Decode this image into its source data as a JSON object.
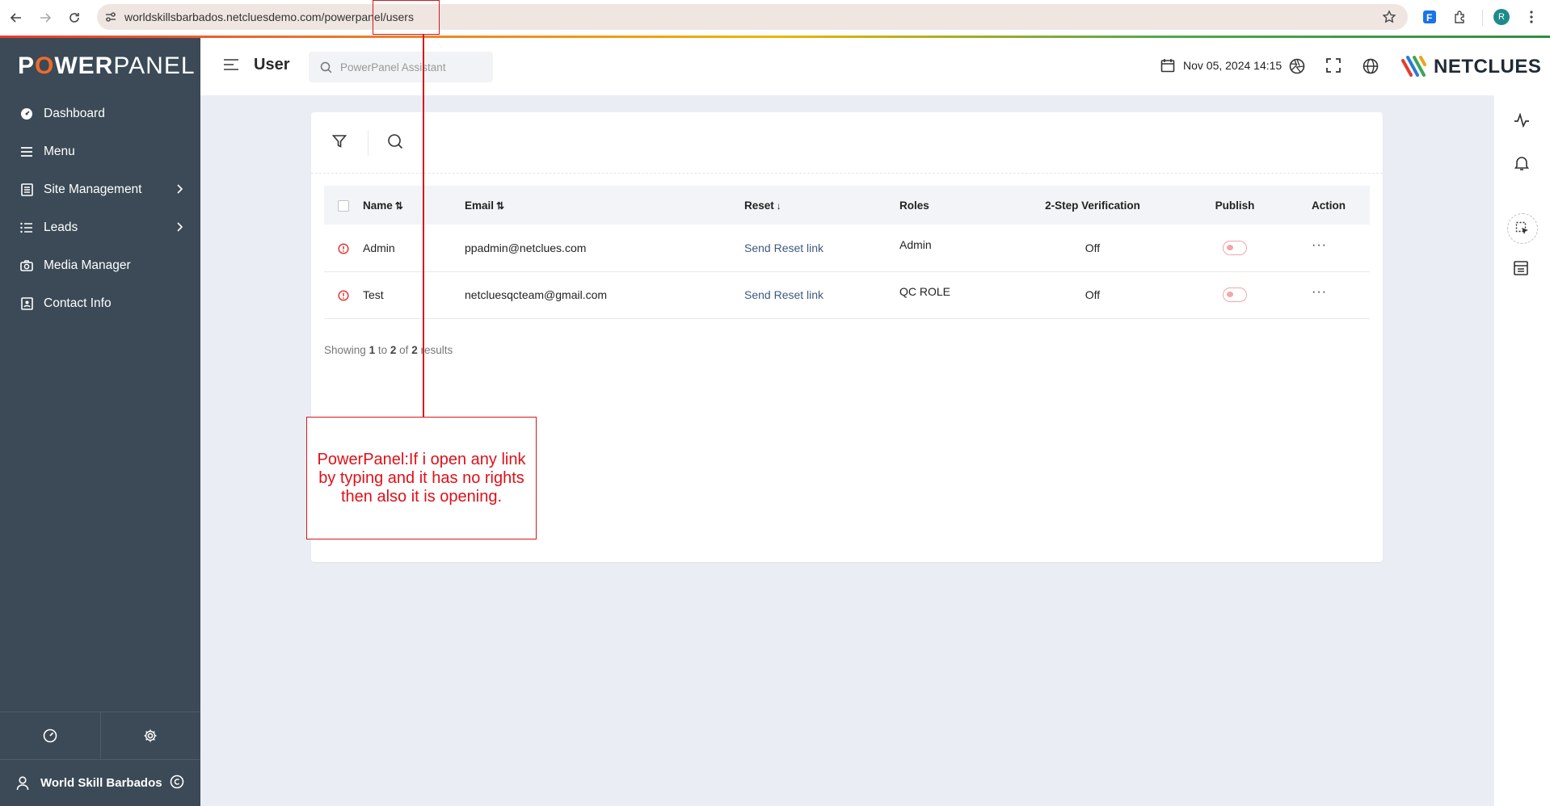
{
  "browser": {
    "url": "worldskillsbarbados.netcluesdemo.com/powerpanel/users",
    "profile_initial": "R",
    "ext_label": "F"
  },
  "sidebar": {
    "logo": {
      "part1": "P",
      "part2": "O",
      "part3": "WER",
      "part4": "PANEL"
    },
    "items": [
      {
        "label": "Dashboard",
        "icon": "dashboard-icon",
        "has_chevron": false
      },
      {
        "label": "Menu",
        "icon": "menu-lines-icon",
        "has_chevron": false
      },
      {
        "label": "Site Management",
        "icon": "site-management-icon",
        "has_chevron": true
      },
      {
        "label": "Leads",
        "icon": "leads-list-icon",
        "has_chevron": true
      },
      {
        "label": "Media Manager",
        "icon": "camera-icon",
        "has_chevron": false
      },
      {
        "label": "Contact Info",
        "icon": "contact-card-icon",
        "has_chevron": false
      }
    ],
    "user_name": "World Skill Barbados"
  },
  "header": {
    "title": "User",
    "search_placeholder": "PowerPanel Assistant",
    "datetime": "Nov 05, 2024 14:15",
    "brand": "NETCLUES"
  },
  "table": {
    "columns": {
      "name": "Name",
      "email": "Email",
      "reset": "Reset",
      "roles": "Roles",
      "two_step": "2-Step Verification",
      "publish": "Publish",
      "action": "Action"
    },
    "sort_icons": {
      "name": "⇅",
      "email": "⇅",
      "reset": "↓"
    },
    "rows": [
      {
        "name": "Admin",
        "email": "ppadmin@netclues.com",
        "reset": "Send Reset link",
        "role": "Admin",
        "two_step": "Off",
        "publish": false,
        "action": "···"
      },
      {
        "name": "Test",
        "email": "netcluesqcteam@gmail.com",
        "reset": "Send Reset link",
        "role": "QC ROLE",
        "two_step": "Off",
        "publish": false,
        "action": "···"
      }
    ]
  },
  "pagination": {
    "prefix": "Showing",
    "from": "1",
    "to_word": "to",
    "to": "2",
    "of_word": "of",
    "total": "2",
    "suffix": "results"
  },
  "annotation": {
    "text": "PowerPanel:If i open any link by typing and it has no rights then also it is opening.",
    "color": "#d9151b"
  },
  "colors": {
    "sidebar_bg": "#3b4a56",
    "logo_accent": "#ef6b2d",
    "link": "#3c5a82",
    "toggle_off": "#f0a8a8"
  }
}
